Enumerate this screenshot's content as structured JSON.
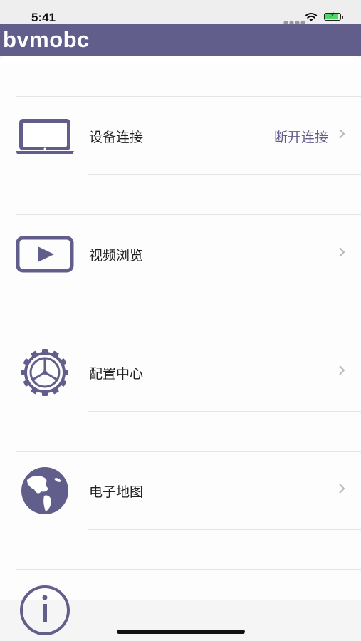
{
  "status_bar": {
    "time": "5:41",
    "signal_icon": "signal-dots-icon",
    "wifi_icon": "wifi-icon",
    "battery_icon": "battery-charging-icon",
    "battery_color": "#4cd964"
  },
  "nav": {
    "title": "bvmobc",
    "background": "#625e8c"
  },
  "menu": {
    "accent": "#625e8c",
    "items": [
      {
        "label": "设备连接",
        "detail": "断开连接",
        "icon": "laptop-icon"
      },
      {
        "label": "视频浏览",
        "detail": "",
        "icon": "play-video-icon"
      },
      {
        "label": "配置中心",
        "detail": "",
        "icon": "gear-icon"
      },
      {
        "label": "电子地图",
        "detail": "",
        "icon": "globe-icon"
      },
      {
        "label": "",
        "detail": "",
        "icon": "info-icon"
      }
    ]
  }
}
